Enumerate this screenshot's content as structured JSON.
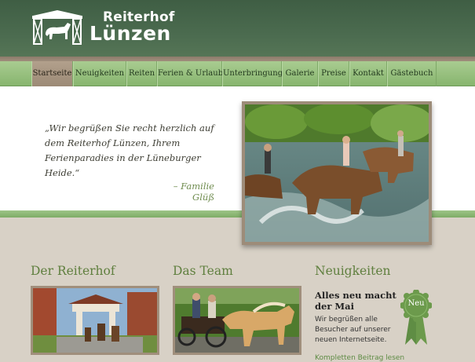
{
  "header": {
    "logo_line1": "Reiterhof",
    "logo_line2": "Lünzen"
  },
  "nav": {
    "items": [
      {
        "label": "Startseite",
        "active": true
      },
      {
        "label": "Neuigkeiten",
        "active": false
      },
      {
        "label": "Reiten",
        "active": false
      },
      {
        "label": "Ferien & Urlaub",
        "active": false
      },
      {
        "label": "Unterbringung",
        "active": false
      },
      {
        "label": "Galerie",
        "active": false
      },
      {
        "label": "Preise",
        "active": false
      },
      {
        "label": "Kontakt",
        "active": false
      },
      {
        "label": "Gästebuch",
        "active": false
      }
    ]
  },
  "intro": {
    "quote": "„Wir begrüßen Sie recht herzlich auf dem Reiterhof Lünzen, Ihrem Ferienparadies in der Lüneburger Heide.“",
    "signature": "– Familie Glüß"
  },
  "sections": {
    "reiterhof_title": "Der Reiterhof",
    "team_title": "Das Team",
    "news_title": "Neuigkeiten"
  },
  "news": {
    "headline": "Alles neu macht der Mai",
    "text": "Wir begrüßen alle Besucher auf unserer neuen Internetseite.",
    "link": "Kompletten Beitrag lesen",
    "badge": "Neu"
  },
  "colors": {
    "header_green": "#4b6b4f",
    "nav_green": "#9cc283",
    "active_tab": "#a8967f",
    "heading_green": "#5f7f3e",
    "badge_green": "#6c9a4c"
  }
}
